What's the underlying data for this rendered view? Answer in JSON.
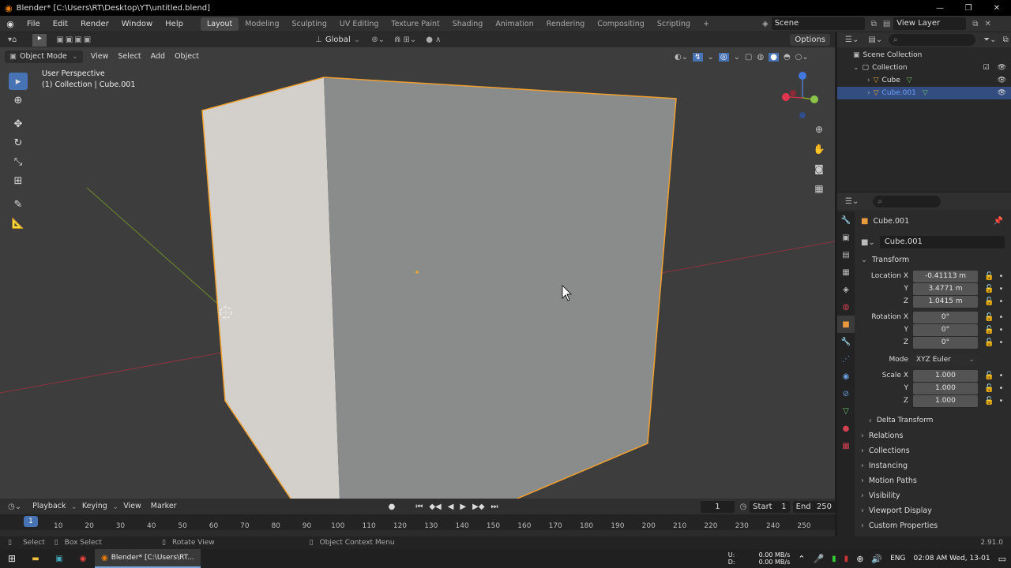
{
  "window": {
    "title": "Blender* [C:\\Users\\RT\\Desktop\\YT\\untitled.blend]",
    "controls": [
      "—",
      "❐",
      "✕"
    ]
  },
  "menu": [
    "File",
    "Edit",
    "Render",
    "Window",
    "Help"
  ],
  "workspaces": [
    "Layout",
    "Modeling",
    "Sculpting",
    "UV Editing",
    "Texture Paint",
    "Shading",
    "Animation",
    "Rendering",
    "Compositing",
    "Scripting",
    "+"
  ],
  "scene": {
    "name": "Scene",
    "view_layer": "View Layer"
  },
  "header": {
    "orientation": "Global",
    "options": "Options"
  },
  "viewport_header": {
    "mode": "Object Mode",
    "menus": [
      "View",
      "Select",
      "Add",
      "Object"
    ]
  },
  "viewport": {
    "perspective": "User Perspective",
    "collection": "(1) Collection | Cube.001"
  },
  "outliner": {
    "root": "Scene Collection",
    "items": [
      {
        "label": "Collection"
      },
      {
        "label": "Cube"
      },
      {
        "label": "Cube.001"
      }
    ]
  },
  "properties": {
    "object_name": "Cube.001",
    "object_field": "Cube.001",
    "transform_title": "Transform",
    "location": {
      "label": "Location X",
      "x": "-0.41113 m",
      "y": "3.4771 m",
      "z": "1.0415 m"
    },
    "rotation": {
      "label": "Rotation X",
      "x": "0°",
      "y": "0°",
      "z": "0°"
    },
    "mode": {
      "label": "Mode",
      "value": "XYZ Euler"
    },
    "scale": {
      "label": "Scale X",
      "x": "1.000",
      "y": "1.000",
      "z": "1.000"
    },
    "axis_y": "Y",
    "axis_z": "Z",
    "delta": "Delta Transform",
    "panels": [
      "Relations",
      "Collections",
      "Instancing",
      "Motion Paths",
      "Visibility",
      "Viewport Display",
      "Custom Properties"
    ]
  },
  "timeline": {
    "menus": [
      "Playback",
      "Keying",
      "View",
      "Marker"
    ],
    "current_frame": "1",
    "start_label": "Start",
    "start": "1",
    "end_label": "End",
    "end": "250",
    "frame_marker": "1",
    "ticks": [
      "10",
      "20",
      "30",
      "40",
      "50",
      "60",
      "70",
      "80",
      "90",
      "100",
      "110",
      "120",
      "130",
      "140",
      "150",
      "160",
      "170",
      "180",
      "190",
      "200",
      "210",
      "220",
      "230",
      "240",
      "250"
    ]
  },
  "status": {
    "select": "Select",
    "box_select": "Box Select",
    "rotate_view": "Rotate View",
    "context_menu": "Object Context Menu",
    "version": "2.91.0"
  },
  "taskbar": {
    "app_label": "Blender* [C:\\Users\\RT...",
    "net_up": "0.00 MB/s",
    "net_down": "0.00 MB/s",
    "net_u": "U:",
    "net_d": "D:",
    "lang": "ENG",
    "clock": "02:08 AM Wed, 13-01"
  },
  "colors": {
    "accent": "#4772b3",
    "selection_outline": "#f0a030",
    "x_axis": "#a03040",
    "y_axis": "#7a9a30"
  }
}
